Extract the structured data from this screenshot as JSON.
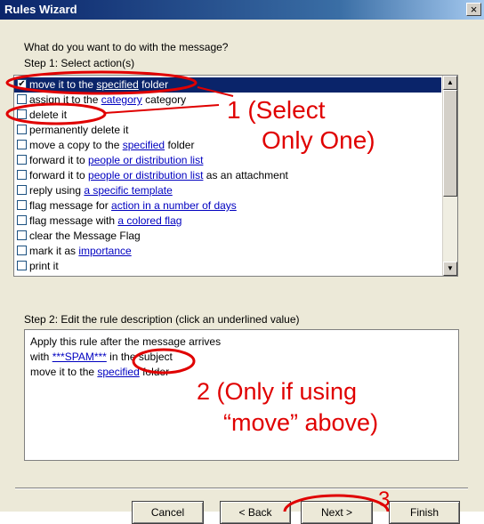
{
  "window": {
    "title": "Rules Wizard",
    "close_glyph": "×"
  },
  "prompt": "What do you want to do with the message?",
  "step1_label": "Step 1: Select action(s)",
  "actions": [
    {
      "checked": true,
      "parts": [
        {
          "t": "move it to the "
        },
        {
          "t": "specified",
          "link": true
        },
        {
          "t": " folder"
        }
      ]
    },
    {
      "checked": false,
      "parts": [
        {
          "t": "assign it to the "
        },
        {
          "t": "category",
          "link": true
        },
        {
          "t": " category"
        }
      ]
    },
    {
      "checked": false,
      "parts": [
        {
          "t": "delete it"
        }
      ]
    },
    {
      "checked": false,
      "parts": [
        {
          "t": "permanently delete it"
        }
      ]
    },
    {
      "checked": false,
      "parts": [
        {
          "t": "move a copy to the "
        },
        {
          "t": "specified",
          "link": true
        },
        {
          "t": " folder"
        }
      ]
    },
    {
      "checked": false,
      "parts": [
        {
          "t": "forward it to "
        },
        {
          "t": "people or distribution list",
          "link": true
        }
      ]
    },
    {
      "checked": false,
      "parts": [
        {
          "t": "forward it to "
        },
        {
          "t": "people or distribution list",
          "link": true
        },
        {
          "t": " as an attachment"
        }
      ]
    },
    {
      "checked": false,
      "parts": [
        {
          "t": "reply using "
        },
        {
          "t": "a specific template",
          "link": true
        }
      ]
    },
    {
      "checked": false,
      "parts": [
        {
          "t": "flag message for "
        },
        {
          "t": "action in a number of days",
          "link": true
        }
      ]
    },
    {
      "checked": false,
      "parts": [
        {
          "t": "flag message with "
        },
        {
          "t": "a colored flag",
          "link": true
        }
      ]
    },
    {
      "checked": false,
      "parts": [
        {
          "t": "clear the Message Flag"
        }
      ]
    },
    {
      "checked": false,
      "parts": [
        {
          "t": "mark it as "
        },
        {
          "t": "importance",
          "link": true
        }
      ]
    },
    {
      "checked": false,
      "parts": [
        {
          "t": "print it"
        }
      ]
    }
  ],
  "step2_label": "Step 2: Edit the rule description (click an underlined value)",
  "description": {
    "line1": "Apply this rule after the message arrives",
    "line2_prefix": "with ",
    "line2_link": "***SPAM***",
    "line2_suffix": " in the subject",
    "line3_prefix": "move it to the ",
    "line3_link": "specified",
    "line3_suffix": " folder"
  },
  "buttons": {
    "cancel": "Cancel",
    "back": "< Back",
    "next": "Next >",
    "finish": "Finish"
  },
  "annotations": {
    "a1_line1": "1 (Select",
    "a1_line2": "Only One)",
    "a2_line1": "2 (Only if using",
    "a2_line2": "“move” above)",
    "a3": "3"
  },
  "colors": {
    "title_bar": "#0a246a",
    "selection": "#0a246a",
    "link": "#0000c0",
    "annotation": "#e00000",
    "dialog_bg": "#ece9d8"
  }
}
